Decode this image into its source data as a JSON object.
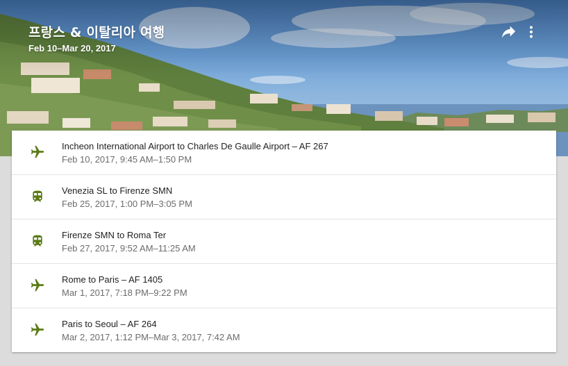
{
  "trip": {
    "title": "프랑스 & 이탈리아 여행",
    "dates": "Feb 10–Mar 20, 2017"
  },
  "actions": {
    "share_icon": "share-arrow-icon",
    "more_icon": "more-vert-icon"
  },
  "colors": {
    "accent": "#5b7a16",
    "title_text": "#212121",
    "secondary_text": "#6b6b6b"
  },
  "reservations": [
    {
      "type": "flight",
      "icon": "airplane-icon",
      "title": "Incheon International Airport to Charles De Gaulle Airport – AF 267",
      "time": "Feb 10, 2017, 9:45 AM–1:50 PM"
    },
    {
      "type": "train",
      "icon": "train-icon",
      "title": "Venezia SL to Firenze SMN",
      "time": "Feb 25, 2017, 1:00 PM–3:05 PM"
    },
    {
      "type": "train",
      "icon": "train-icon",
      "title": "Firenze SMN to Roma Ter",
      "time": "Feb 27, 2017, 9:52 AM–11:25 AM"
    },
    {
      "type": "flight",
      "icon": "airplane-icon",
      "title": "Rome to Paris – AF 1405",
      "time": "Mar 1, 2017, 7:18 PM–9:22 PM"
    },
    {
      "type": "flight",
      "icon": "airplane-icon",
      "title": "Paris to Seoul – AF 264",
      "time": "Mar 2, 2017, 1:12 PM–Mar 3, 2017, 7:42 AM"
    }
  ]
}
